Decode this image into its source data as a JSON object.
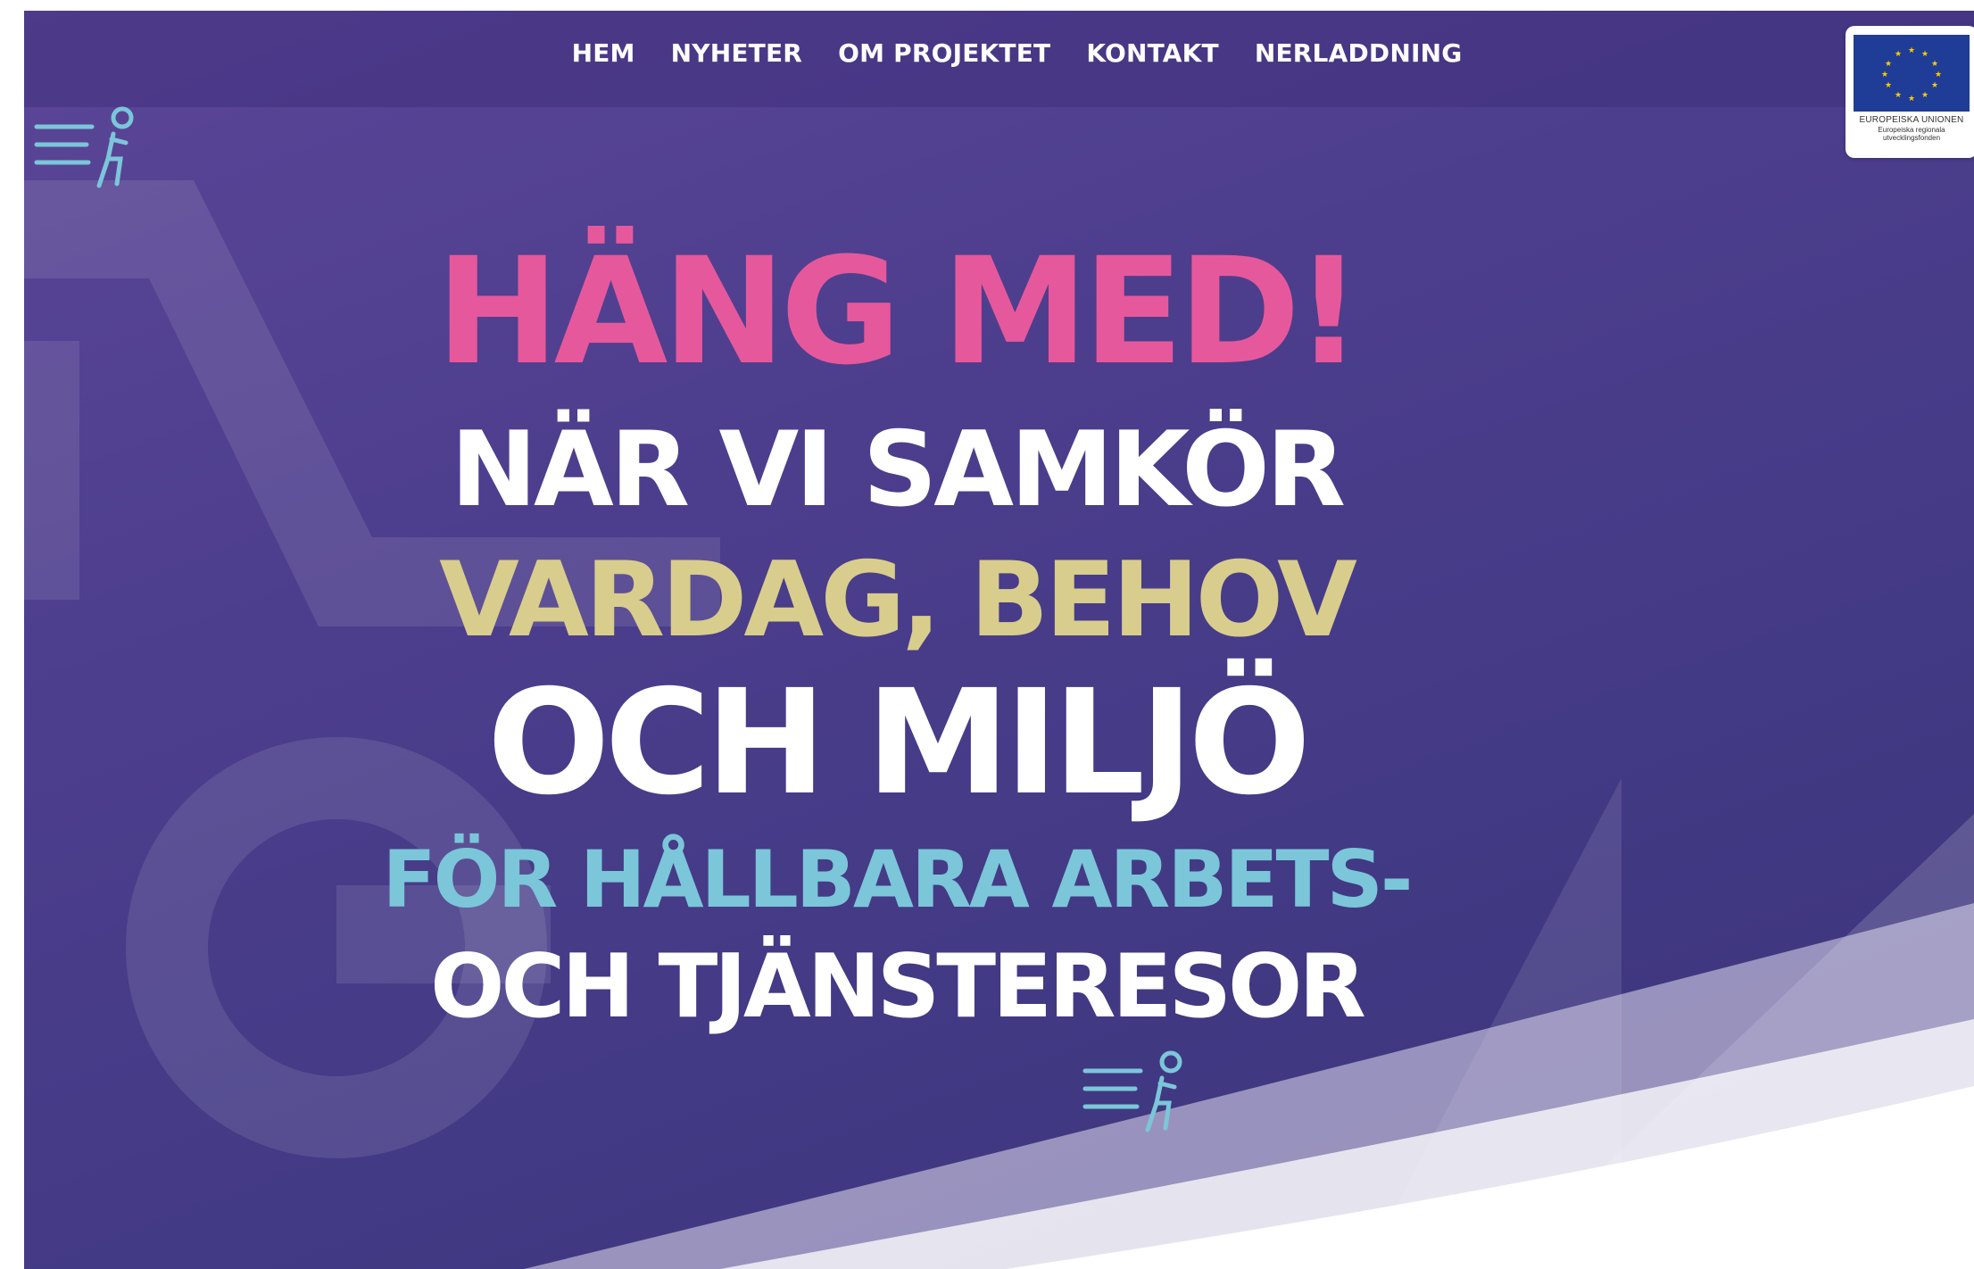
{
  "nav": {
    "items": [
      "HEM",
      "NYHETER",
      "OM PROJEKTET",
      "KONTAKT",
      "NERLADDNING"
    ]
  },
  "eu_logo": {
    "title": "EUROPEISKA UNIONEN",
    "subtitle_line1": "Europeiska regionala",
    "subtitle_line2": "utvecklingsfonden"
  },
  "hero": {
    "line1": "HÄNG MED!",
    "line2": "NÄR VI SAMKÖR",
    "line3": "VARDAG, BEHOV",
    "line4": "OCH MILJÖ",
    "line5": "FÖR HÅLLBARA ARBETS-",
    "line6": "OCH TJÄNSTERESOR"
  },
  "colors": {
    "background": "#4d3e8d",
    "accent_pink": "#e6589c",
    "accent_sand": "#d8cd8c",
    "accent_teal": "#7bc6d9",
    "text_white": "#ffffff"
  },
  "icons": {
    "brand": "runner-speed-icon",
    "eu": "eu-flag-icon"
  }
}
